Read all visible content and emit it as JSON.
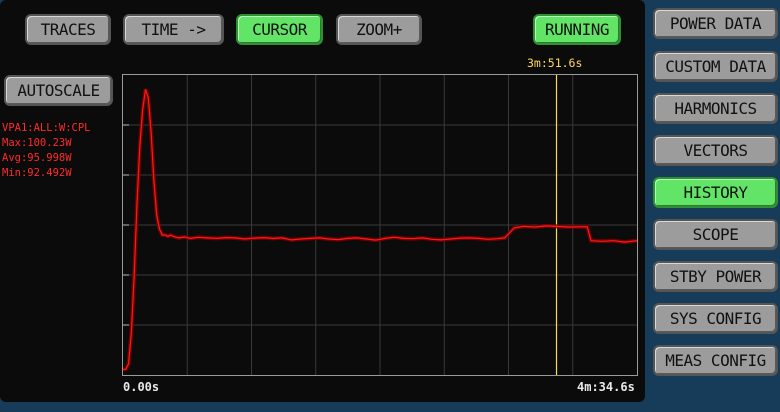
{
  "toolbar": {
    "traces": "TRACES",
    "time": "TIME ->",
    "cursor": "CURSOR",
    "zoom": "ZOOM+",
    "running": "RUNNING"
  },
  "autoscale": "AUTOSCALE",
  "stats": {
    "channel": "VPA1:ALL:W:CPL",
    "max": "Max:100.23W",
    "avg": "Avg:95.998W",
    "min": "Min:92.492W"
  },
  "cursor": {
    "label": "3m:51.6s"
  },
  "axis": {
    "start": "0.00s",
    "end": "4m:34.6s"
  },
  "menu": [
    {
      "label": "POWER DATA",
      "active": false
    },
    {
      "label": "CUSTOM DATA",
      "active": false
    },
    {
      "label": "HARMONICS",
      "active": false
    },
    {
      "label": "VECTORS",
      "active": false
    },
    {
      "label": "HISTORY",
      "active": true
    },
    {
      "label": "SCOPE",
      "active": false
    },
    {
      "label": "STBY POWER",
      "active": false
    },
    {
      "label": "SYS CONFIG",
      "active": false
    },
    {
      "label": "MEAS CONFIG",
      "active": false
    }
  ],
  "colors": {
    "trace": "#ff1a1a",
    "cursor": "#ffd75e",
    "active_button": "#62e466",
    "inactive_button": "#9c9c9c",
    "stat_text": "#ff2a2a"
  },
  "chart_data": {
    "type": "line",
    "x_unit": "s",
    "xlim": [
      0,
      274.6
    ],
    "ylim": [
      0,
      105
    ],
    "cursor_x": 231.6,
    "grid": true,
    "series": [
      {
        "x": [
          0,
          1.5,
          3,
          4.5,
          6,
          7.5,
          9,
          10.5,
          12,
          13.5,
          15,
          16.5,
          18,
          19.5,
          21,
          22.5,
          24,
          25.5,
          27,
          28.5,
          30,
          33,
          36,
          40,
          45,
          50,
          55,
          60,
          65,
          70,
          75,
          80,
          85,
          90,
          95,
          100,
          105,
          110,
          115,
          120,
          125,
          130,
          135,
          140,
          145,
          150,
          155,
          160,
          165,
          170,
          175,
          180,
          185,
          190,
          195,
          200,
          204,
          209,
          214,
          220,
          226,
          232,
          238,
          248,
          250,
          256,
          262,
          268,
          274.6
        ],
        "y": [
          2,
          2,
          4,
          15,
          35,
          60,
          80,
          93,
          100,
          97,
          85,
          68,
          56,
          51,
          49,
          49,
          48.5,
          49,
          48.5,
          48.2,
          48,
          48.3,
          47.8,
          48.2,
          48,
          47.8,
          48.1,
          48,
          47.6,
          47.9,
          48.1,
          47.8,
          48,
          47.3,
          47.6,
          47.8,
          48,
          47.6,
          47.4,
          47.8,
          48,
          47.6,
          47.2,
          47.8,
          48.2,
          47.8,
          47.7,
          48,
          47.5,
          47.3,
          47.6,
          47.9,
          48,
          47.8,
          47.5,
          47.7,
          48,
          51.5,
          52,
          51.8,
          52.2,
          52,
          51.8,
          51.9,
          47,
          46.8,
          47,
          46.5,
          47
        ]
      }
    ]
  }
}
